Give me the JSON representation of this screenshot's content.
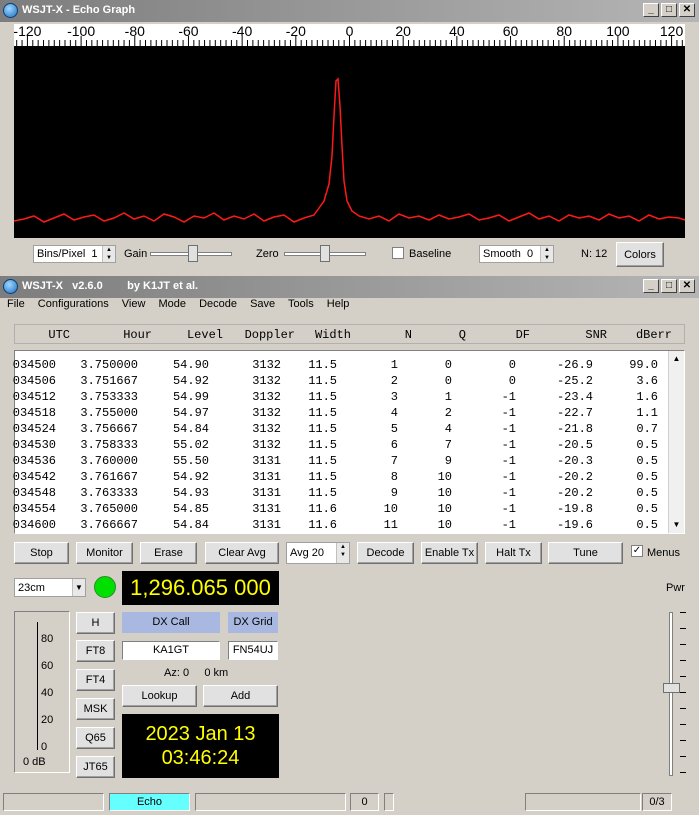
{
  "echo_window": {
    "title": "WSJT-X - Echo Graph",
    "freq_ticks": [
      "-120",
      "-100",
      "-80",
      "-60",
      "-40",
      "-20",
      "0",
      "20",
      "40",
      "60",
      "80",
      "100",
      "120"
    ],
    "controls": {
      "bins_label": "Bins/Pixel",
      "bins_value": "1",
      "gain_label": "Gain",
      "zero_label": "Zero",
      "baseline_label": "Baseline",
      "smooth_label": "Smooth",
      "smooth_value": "0",
      "n_label": "N: 12",
      "colors_label": "Colors"
    },
    "trace_color": "#ff1a1a"
  },
  "main_window": {
    "title": "WSJT-X   v2.6.0        by K1JT et al.",
    "menu": [
      "File",
      "Configurations",
      "View",
      "Mode",
      "Decode",
      "Save",
      "Tools",
      "Help"
    ],
    "columns": [
      "UTC",
      "Hour",
      "Level",
      "Doppler",
      "Width",
      "N",
      "Q",
      "DF",
      "SNR",
      "dBerr"
    ],
    "rows": [
      [
        "034500",
        "3.750000",
        "54.90",
        "3132",
        "11.5",
        "1",
        "0",
        "0",
        "-26.9",
        "99.0"
      ],
      [
        "034506",
        "3.751667",
        "54.92",
        "3132",
        "11.5",
        "2",
        "0",
        "0",
        "-25.2",
        "3.6"
      ],
      [
        "034512",
        "3.753333",
        "54.99",
        "3132",
        "11.5",
        "3",
        "1",
        "-1",
        "-23.4",
        "1.6"
      ],
      [
        "034518",
        "3.755000",
        "54.97",
        "3132",
        "11.5",
        "4",
        "2",
        "-1",
        "-22.7",
        "1.1"
      ],
      [
        "034524",
        "3.756667",
        "54.84",
        "3132",
        "11.5",
        "5",
        "4",
        "-1",
        "-21.8",
        "0.7"
      ],
      [
        "034530",
        "3.758333",
        "55.02",
        "3132",
        "11.5",
        "6",
        "7",
        "-1",
        "-20.5",
        "0.5"
      ],
      [
        "034536",
        "3.760000",
        "55.50",
        "3131",
        "11.5",
        "7",
        "9",
        "-1",
        "-20.3",
        "0.5"
      ],
      [
        "034542",
        "3.761667",
        "54.92",
        "3131",
        "11.5",
        "8",
        "10",
        "-1",
        "-20.2",
        "0.5"
      ],
      [
        "034548",
        "3.763333",
        "54.93",
        "3131",
        "11.5",
        "9",
        "10",
        "-1",
        "-20.2",
        "0.5"
      ],
      [
        "034554",
        "3.765000",
        "54.85",
        "3131",
        "11.6",
        "10",
        "10",
        "-1",
        "-19.8",
        "0.5"
      ],
      [
        "034600",
        "3.766667",
        "54.84",
        "3131",
        "11.6",
        "11",
        "10",
        "-1",
        "-19.6",
        "0.5"
      ]
    ],
    "buttons": {
      "stop": "Stop",
      "monitor": "Monitor",
      "erase": "Erase",
      "clear_avg": "Clear Avg",
      "avg_value": "Avg 20",
      "decode": "Decode",
      "enable_tx": "Enable Tx",
      "halt_tx": "Halt Tx",
      "tune": "Tune",
      "menus": "Menus"
    },
    "band": "23cm",
    "frequency": "1,296.065 000",
    "level_ticks": [
      "80",
      "60",
      "40",
      "20",
      "0"
    ],
    "level_db": "0 dB",
    "mode_buttons": [
      "H",
      "FT8",
      "FT4",
      "MSK",
      "Q65",
      "JT65"
    ],
    "dx_call_label": "DX Call",
    "dx_grid_label": "DX Grid",
    "dx_call": "KA1GT",
    "dx_grid": "FN54UJ",
    "az_dist": "Az: 0     0 km",
    "lookup": "Lookup",
    "add": "Add",
    "date": "2023 Jan 13",
    "time": "03:46:24",
    "pwr_label": "Pwr",
    "status": {
      "mode": "Echo",
      "count": "0",
      "tx_count": "0/3"
    }
  },
  "colors": {
    "led": "#00e000",
    "echo_status": "#66ffff",
    "dx_label_bg": "#a8b8e0",
    "display_text": "#ffff00"
  }
}
